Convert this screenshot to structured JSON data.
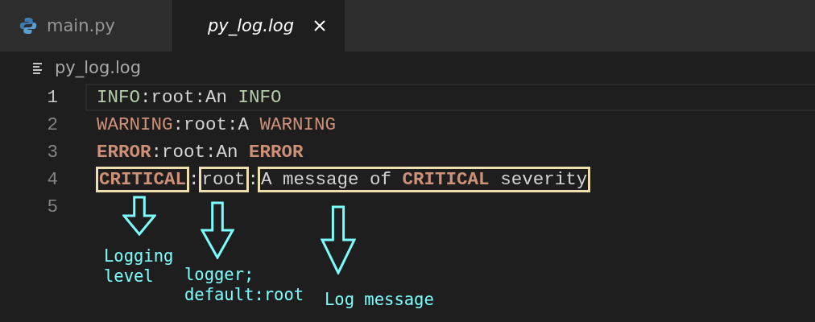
{
  "tabs": [
    {
      "label": "main.py",
      "selected": false
    },
    {
      "label": "py_log.log",
      "selected": true
    }
  ],
  "breadcrumb": {
    "label": "py_log.log"
  },
  "lines": [
    {
      "number": "1",
      "current": true,
      "segments": [
        {
          "text": "INFO",
          "kind": "info"
        },
        {
          "text": ":root:An ",
          "kind": "plain"
        },
        {
          "text": "INFO",
          "kind": "info"
        }
      ]
    },
    {
      "number": "2",
      "current": false,
      "segments": [
        {
          "text": "WARNING",
          "kind": "warning"
        },
        {
          "text": ":root:A ",
          "kind": "plain"
        },
        {
          "text": "WARNING",
          "kind": "warning"
        }
      ]
    },
    {
      "number": "3",
      "current": false,
      "segments": [
        {
          "text": "ERROR",
          "kind": "error"
        },
        {
          "text": ":root:An ",
          "kind": "plain"
        },
        {
          "text": "ERROR",
          "kind": "error"
        }
      ]
    },
    {
      "number": "4",
      "current": false,
      "segments": [
        {
          "kind": "box",
          "parts": [
            {
              "text": "CRITICAL",
              "kind": "error"
            }
          ]
        },
        {
          "text": ":",
          "kind": "plain"
        },
        {
          "kind": "box",
          "parts": [
            {
              "text": "root",
              "kind": "plain"
            }
          ]
        },
        {
          "text": ":",
          "kind": "plain"
        },
        {
          "kind": "box",
          "parts": [
            {
              "text": "A message of ",
              "kind": "plain"
            },
            {
              "text": "CRITICAL",
              "kind": "error"
            },
            {
              "text": " severity",
              "kind": "plain"
            }
          ]
        }
      ]
    },
    {
      "number": "5",
      "current": false
    }
  ],
  "annotations": [
    {
      "text": "Logging\nlevel"
    },
    {
      "text": "logger;\ndefault:root"
    },
    {
      "text": "Log message"
    }
  ]
}
